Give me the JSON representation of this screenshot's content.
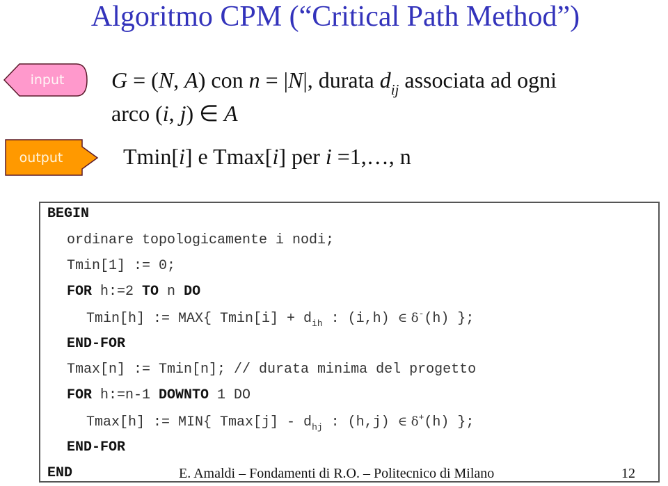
{
  "title": "Algoritmo CPM (“Critical Path Method”)",
  "colors": {
    "title": "#3333bb",
    "input_tag": "#ff99cc",
    "output_tag": "#ff9900",
    "tag_border": "#5a1a2a"
  },
  "tags": {
    "input_label": "input",
    "output_label": "output"
  },
  "description": {
    "line1": {
      "G": "G",
      "eq1": " = (",
      "N": "N",
      "comma": ", ",
      "A": "A",
      "con": ") con ",
      "n": "n",
      "eq2": " = |",
      "N2": "N",
      "durata": "|, durata ",
      "d": "d",
      "ij": "ij",
      "rest": " associata ad ogni"
    },
    "line2": {
      "arco": "arco (",
      "i": "i",
      "comma": ", ",
      "j": "j",
      "close": ") ∈ ",
      "A": "A"
    },
    "line3": {
      "tmin": "Tmin[",
      "i1": "i",
      "mid": "] e Tmax[",
      "i2": "i",
      "per": "] per ",
      "i3": "i",
      "range": " =1,…, n"
    }
  },
  "code": {
    "begin": "BEGIN",
    "l1": "ordinare topologicamente i nodi;",
    "l2": "Tmin[1] := 0;",
    "l3": {
      "kw_for": "FOR",
      "h": " h:=2 ",
      "kw_to": "TO",
      "n": " n ",
      "kw_do": "DO"
    },
    "l4": {
      "pre": "Tmin[h] := MAX{ Tmin[i] + d",
      "sub": "ih",
      "mid": " : (i,h) ",
      "elem": "∈",
      "delta": " δ",
      "sup": "-",
      "post": "(h) };"
    },
    "l5": "END-FOR",
    "l6": "Tmax[n] := Tmin[n]; // durata minima del progetto",
    "l7": {
      "kw_for": "FOR",
      "h": " h:=n-1 ",
      "kw_downto": "DOWNTO",
      "rest": " 1 DO"
    },
    "l8": {
      "pre": "Tmax[h] := MIN{ Tmax[j] - d",
      "sub": "hj",
      "mid": " : (h,j) ",
      "elem": "∈",
      "delta": " δ",
      "sup": "+",
      "post": "(h) };"
    },
    "l9": "END-FOR",
    "end": "END"
  },
  "footer": {
    "text": "E. Amaldi – Fondamenti di R.O. – Politecnico di Milano",
    "page": "12"
  }
}
